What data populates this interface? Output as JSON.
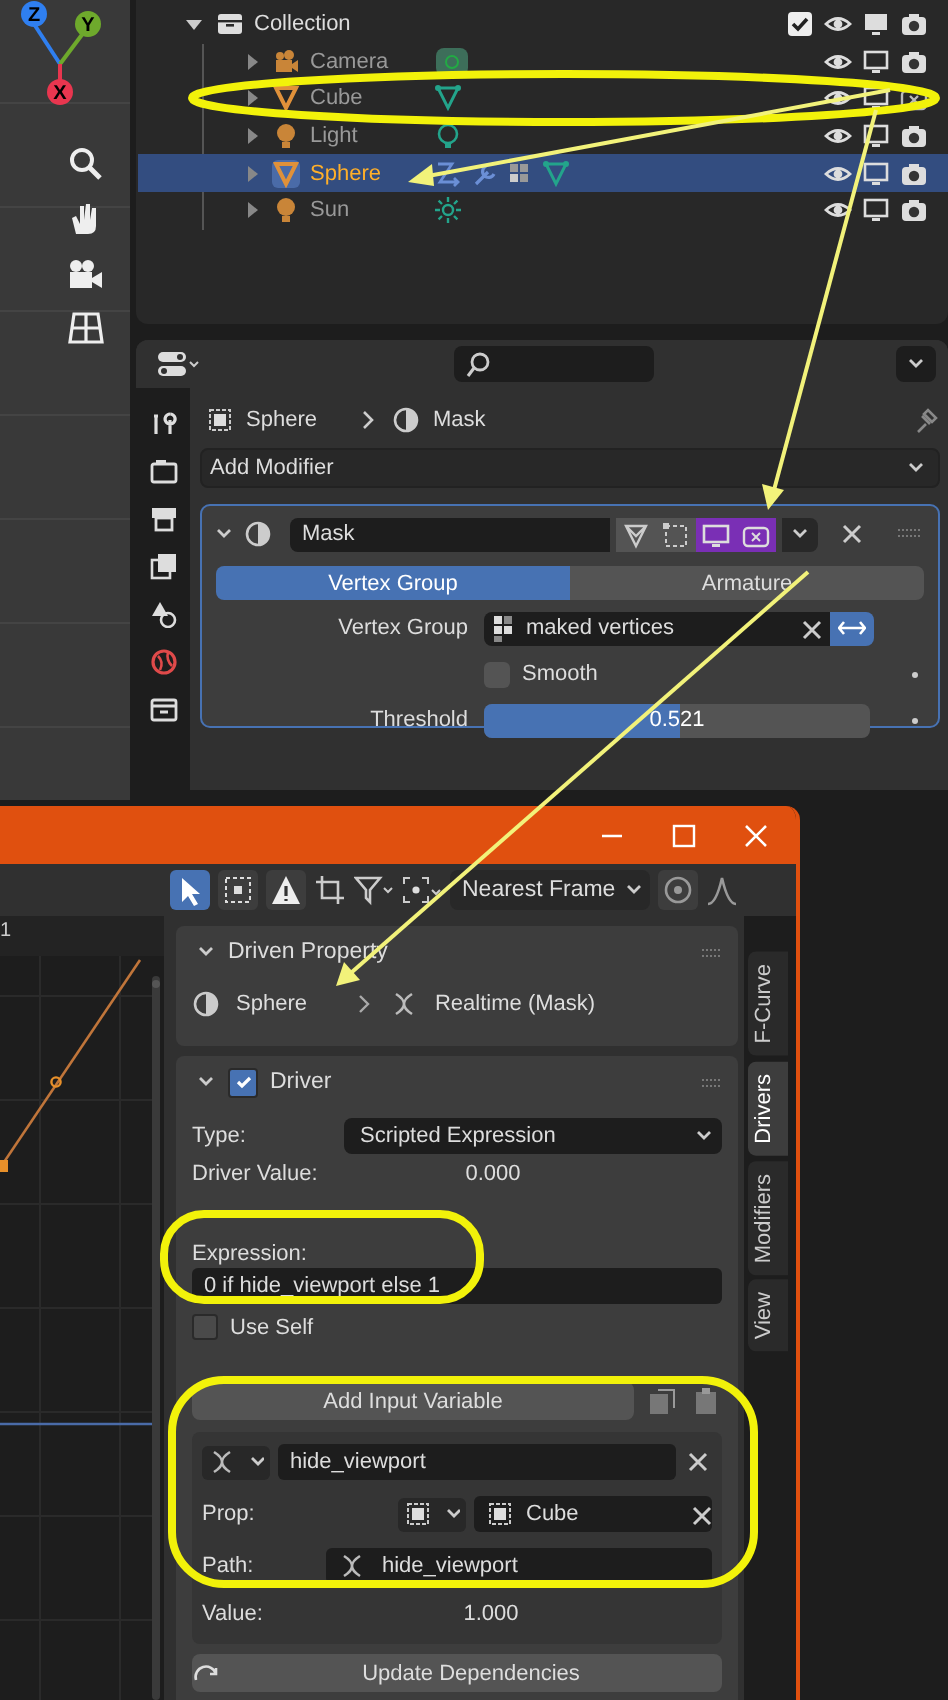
{
  "viewport": {
    "axes": [
      {
        "label": "Z",
        "color": "#2f7ff0"
      },
      {
        "label": "Y",
        "color": "#6ea92c"
      },
      {
        "label": "X",
        "color": "#e8364f"
      }
    ]
  },
  "outliner": {
    "collection": {
      "name": "Collection",
      "expanded": true,
      "checked": true,
      "children": [
        {
          "name": "Camera",
          "kind": "camera",
          "selected": false,
          "has_modifiers": false,
          "render_disabled": false
        },
        {
          "name": "Cube",
          "kind": "mesh",
          "selected": false,
          "has_modifiers": false,
          "render_disabled": true
        },
        {
          "name": "Light",
          "kind": "light",
          "selected": false,
          "has_modifiers": false,
          "render_disabled": false
        },
        {
          "name": "Sphere",
          "kind": "mesh",
          "selected": true,
          "has_modifiers": true,
          "render_disabled": false
        },
        {
          "name": "Sun",
          "kind": "sun",
          "selected": false,
          "has_modifiers": false,
          "render_disabled": false
        }
      ]
    }
  },
  "properties": {
    "breadcrumb": [
      "Sphere",
      "Mask"
    ],
    "add_modifier": "Add Modifier",
    "modifier": {
      "name": "Mask",
      "toggles": [
        {
          "kind": "editmode",
          "on": false
        },
        {
          "kind": "cage",
          "on": false
        },
        {
          "kind": "viewport",
          "on": true
        },
        {
          "kind": "render",
          "on": true
        }
      ],
      "tabs": [
        {
          "label": "Vertex Group",
          "selected": true
        },
        {
          "label": "Armature",
          "selected": false
        }
      ],
      "vertex_group": {
        "label": "Vertex Group",
        "value": "maked vertices",
        "invert": true
      },
      "smooth": {
        "label": "Smooth",
        "checked": false
      },
      "threshold": {
        "label": "Threshold",
        "reading": "0.521",
        "level": 0.51
      }
    }
  },
  "driver_editor": {
    "header_tools": [
      {
        "kind": "select",
        "on": true
      },
      {
        "kind": "box",
        "on": false
      },
      {
        "kind": "warning",
        "on": false
      }
    ],
    "interpolation": "Nearest Frame",
    "frame_label": "1",
    "driven_property": {
      "title": "Driven Property",
      "object": "Sphere",
      "property": "Realtime (Mask)"
    },
    "driver": {
      "title": "Driver",
      "enabled": true,
      "type_label": "Type:",
      "type": "Scripted Expression",
      "value_label": "Driver Value:",
      "value": "0.000",
      "expression_label": "Expression:",
      "expression": "0 if hide_viewport else 1",
      "use_self": {
        "label": "Use Self",
        "checked": false
      },
      "add_variable": "Add Input Variable",
      "variable": {
        "name": "hide_viewport",
        "prop_label": "Prop:",
        "prop": "Cube",
        "path_label": "Path:",
        "path": "hide_viewport",
        "value_label": "Value:",
        "value": "1.000"
      },
      "update": "Update Dependencies"
    },
    "side_tabs": [
      {
        "label": "F-Curve",
        "selected": false
      },
      {
        "label": "Drivers",
        "selected": true
      },
      {
        "label": "Modifiers",
        "selected": false
      },
      {
        "label": "View",
        "selected": false
      }
    ]
  }
}
